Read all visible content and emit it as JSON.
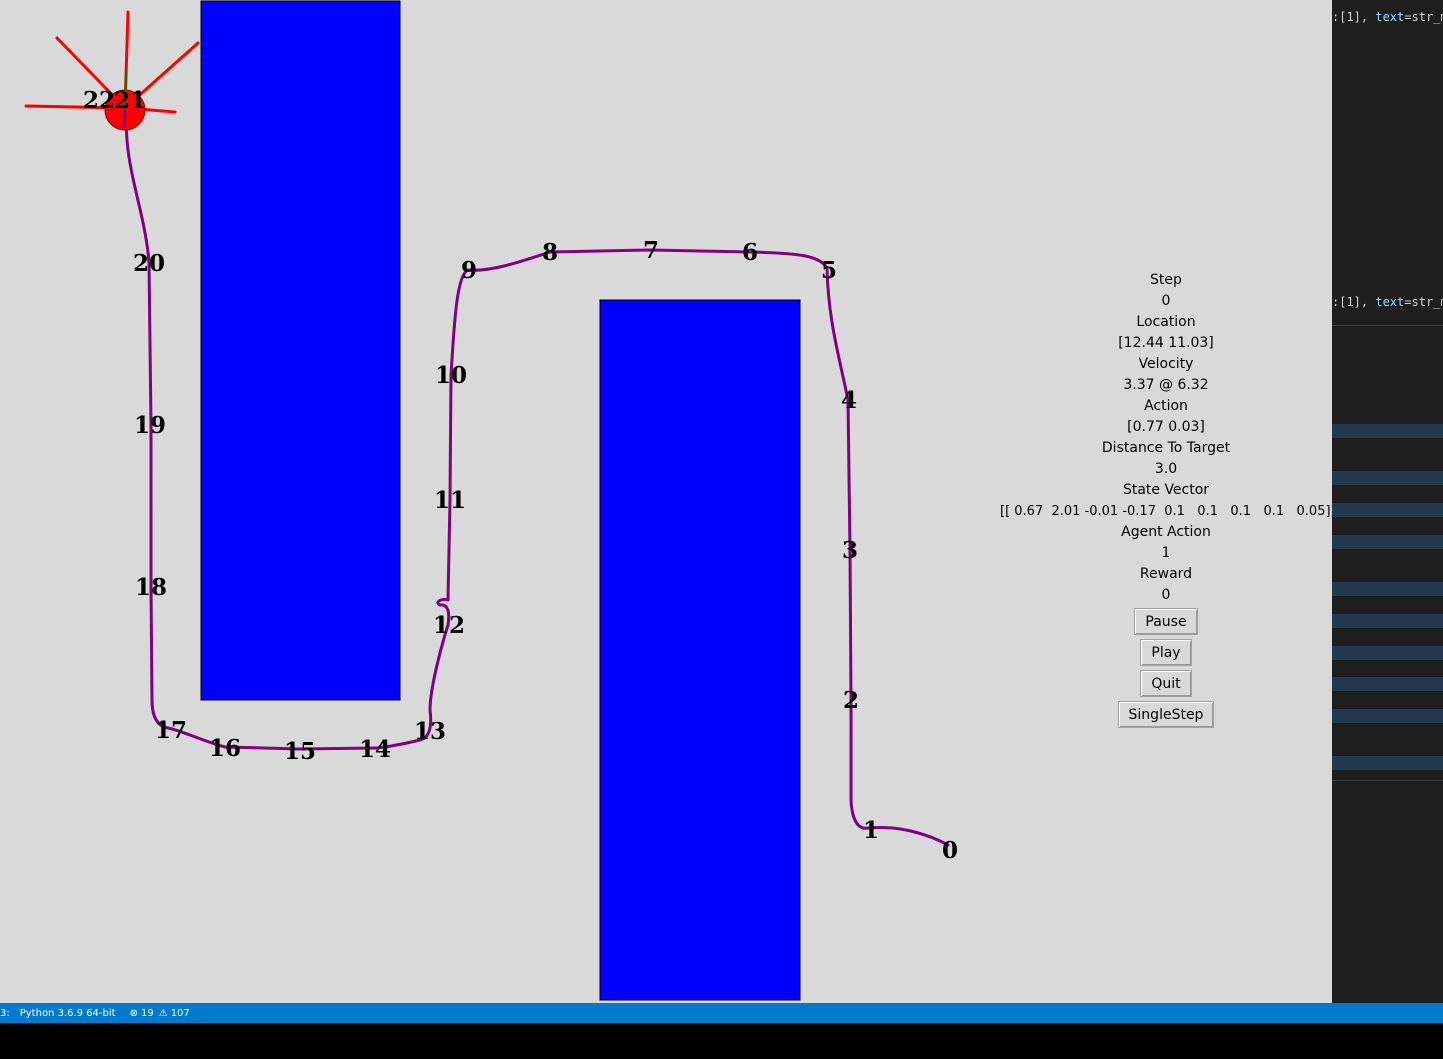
{
  "info_panel": {
    "step_label": "Step",
    "step_value": "0",
    "location_label": "Location",
    "location_value": "[12.44 11.03]",
    "velocity_label": "Velocity",
    "velocity_value": "3.37 @ 6.32",
    "action_label": "Action",
    "action_value": "[0.77 0.03]",
    "distance_label": "Distance To Target",
    "distance_value": "3.0",
    "state_vector_label": "State Vector",
    "state_vector_value": "[[ 0.67  2.01 -0.01 -0.17  0.1   0.1   0.1   0.1   0.05]]",
    "agent_action_label": "Agent Action",
    "agent_action_value": "1",
    "reward_label": "Reward",
    "reward_value": "0"
  },
  "buttons": {
    "pause": "Pause",
    "play": "Play",
    "quit": "Quit",
    "single_step": "SingleStep"
  },
  "waypoints": [
    "0",
    "1",
    "2",
    "3",
    "4",
    "5",
    "6",
    "7",
    "8",
    "9",
    "10",
    "11",
    "12",
    "13",
    "14",
    "15",
    "16",
    "17",
    "18",
    "19",
    "20",
    "21",
    "22"
  ],
  "colors": {
    "background": "#d9d9d9",
    "obstacle": "#0000ff",
    "path": "#800080",
    "agent": "#ff0000",
    "sensor_rays": "#ff0000",
    "heading": "#008000"
  },
  "editor_strip": {
    "line1_prefix": ":[1], ",
    "line1_kw": "text",
    "line1_suffix": "=str_ms",
    "line2_prefix": ":[1], ",
    "line2_kw": "text",
    "line2_suffix": "=str_ms"
  },
  "status_bar": {
    "left_fragment": "3:",
    "python": "Python 3.6.9 64-bit",
    "errors": "19",
    "warnings": "107"
  }
}
